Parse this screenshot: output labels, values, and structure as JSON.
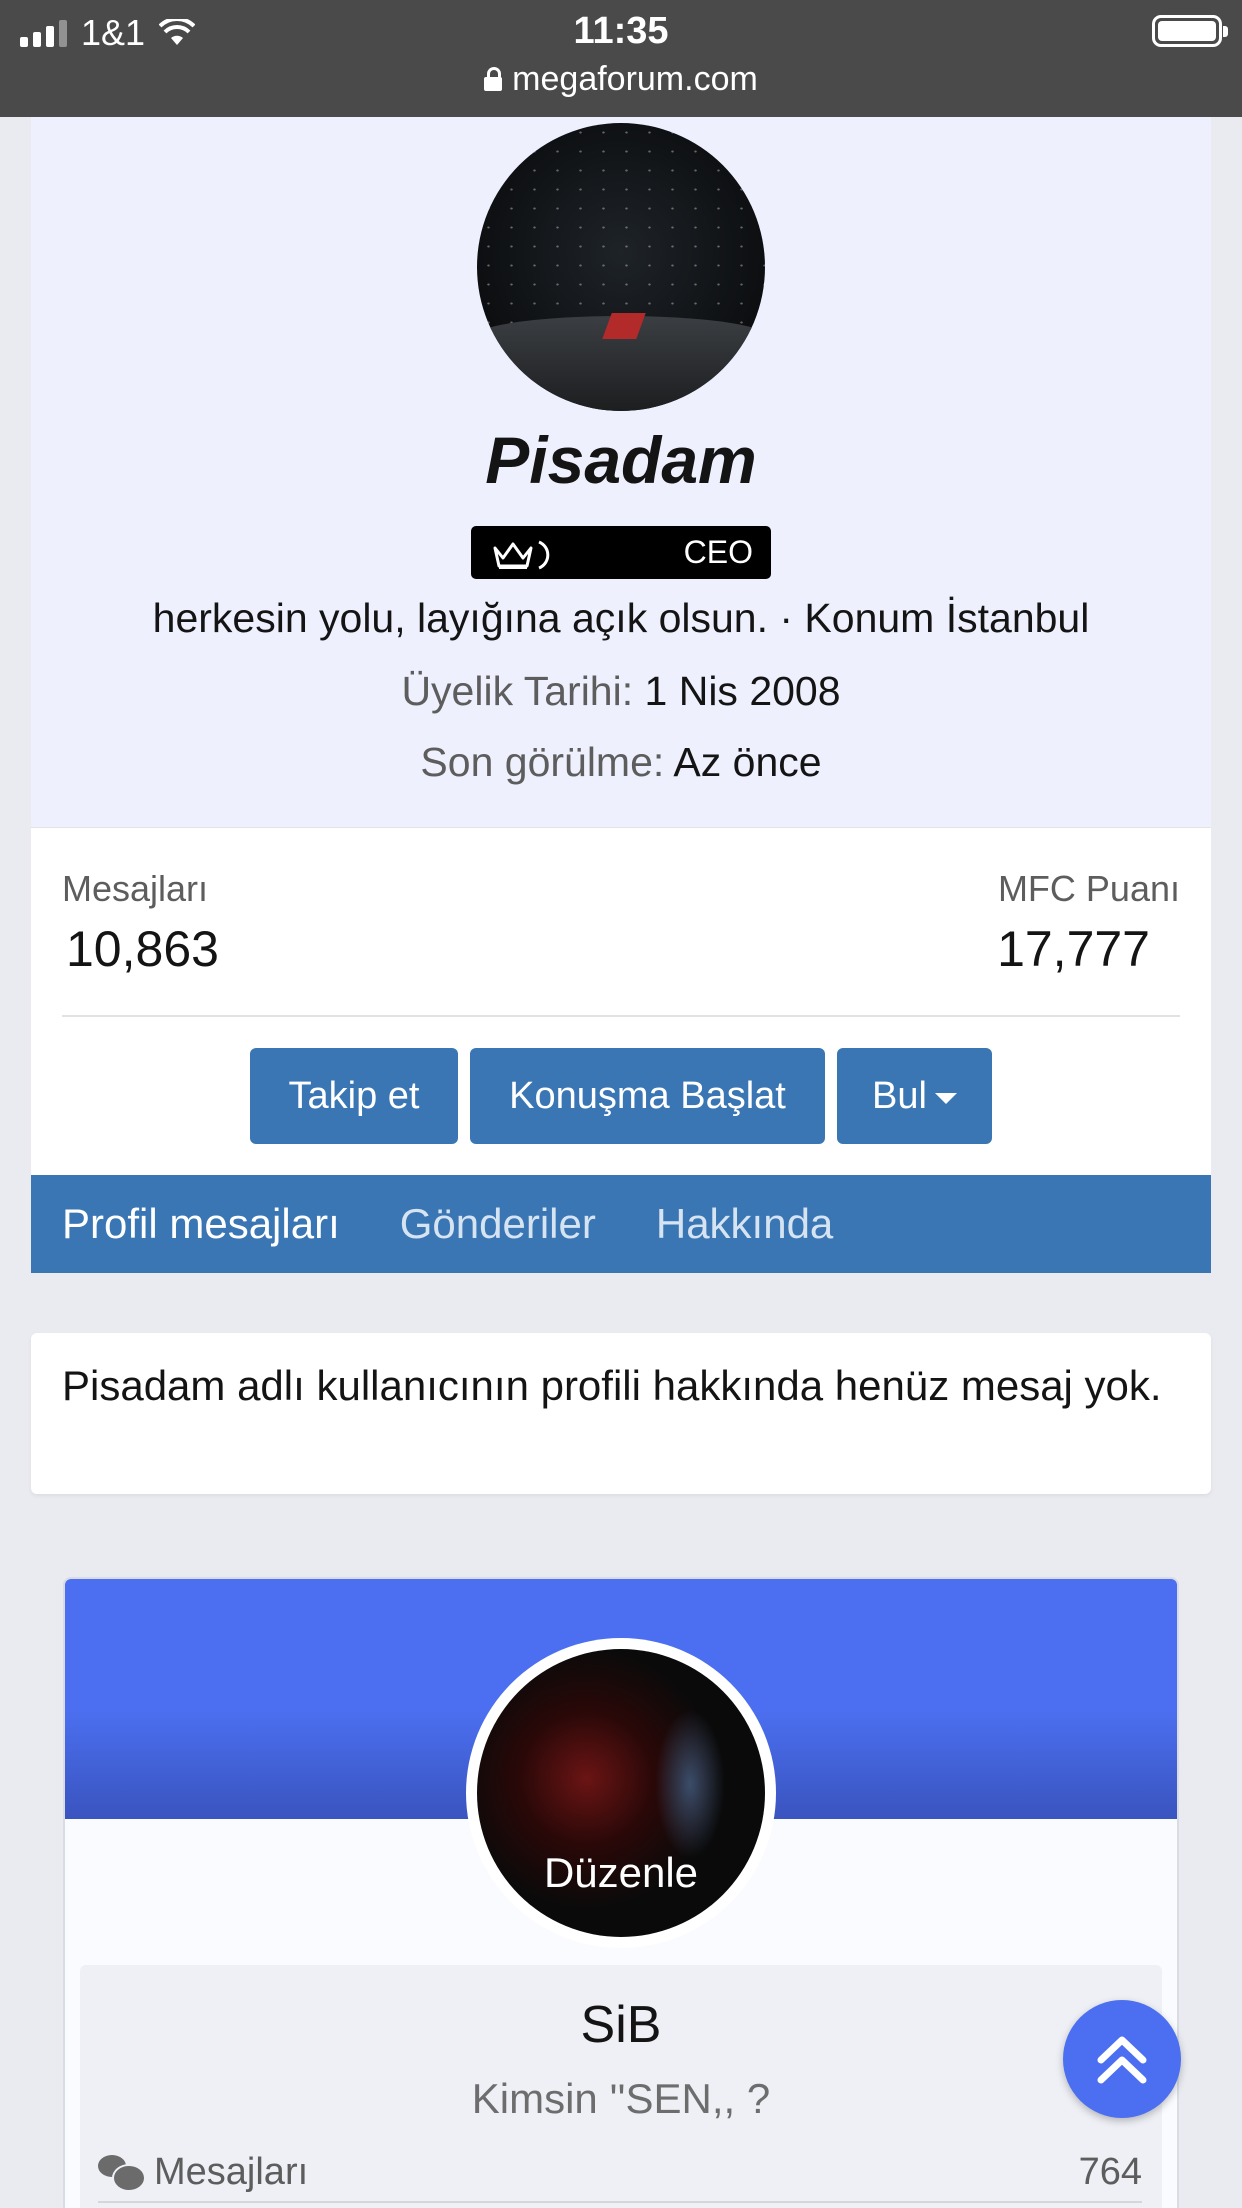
{
  "status_bar": {
    "carrier": "1&1",
    "time": "11:35",
    "url": "megaforum.com"
  },
  "profile": {
    "username": "Pisadam",
    "badge_label": "CEO",
    "bio": "herkesin yolu, layığına açık olsun. · Konum İstanbul",
    "joined_label": "Üyelik Tarihi:",
    "joined_value": "1 Nis 2008",
    "seen_label": "Son görülme:",
    "seen_value": "Az önce"
  },
  "stats": {
    "messages_label": "Mesajları",
    "messages_value": "10,863",
    "points_label": "MFC Puanı",
    "points_value": "17,777"
  },
  "actions": {
    "follow": "Takip et",
    "start_conversation": "Konuşma Başlat",
    "find": "Bul"
  },
  "tabs": [
    {
      "label": "Profil mesajları"
    },
    {
      "label": "Gönderiler"
    },
    {
      "label": "Hakkında"
    }
  ],
  "notice": "Pisadam adlı kullanıcının profili hakkında henüz mesaj yok.",
  "widget": {
    "edit_label": "Düzenle",
    "name": "SiB",
    "title": "Kimsin ''SEN,, ?",
    "messages_label": "Mesajları",
    "messages_value": "764"
  },
  "colors": {
    "accent": "#3a76b4",
    "banner": "#4b6ff0",
    "header_bg": "#eef1fd"
  }
}
